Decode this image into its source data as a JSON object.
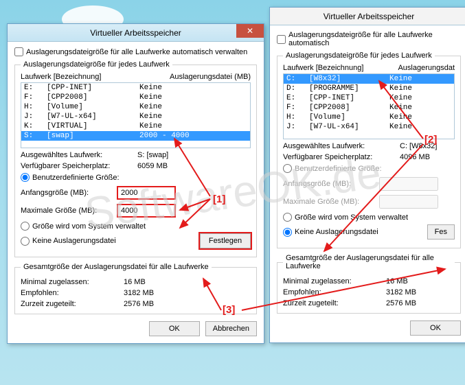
{
  "watermark": "SoftwareOK.de",
  "annotations": {
    "a1": "[1]",
    "a2": "[2]",
    "a3": "[3]"
  },
  "dialog1": {
    "title": "Virtueller Arbeitsspeicher",
    "auto_checkbox_label": "Auslagerungsdateigröße für alle Laufwerke automatisch verwalten",
    "group_label": "Auslagerungsdateigröße für jedes Laufwerk",
    "col_drive": "Laufwerk [Bezeichnung]",
    "col_page": "Auslagerungsdatei (MB)",
    "drives": [
      {
        "d": "E:",
        "n": "[CPP-INET]",
        "p": "Keine"
      },
      {
        "d": "F:",
        "n": "[CPP2008]",
        "p": "Keine"
      },
      {
        "d": "H:",
        "n": "[Volume]",
        "p": "Keine"
      },
      {
        "d": "J:",
        "n": "[W7-UL-x64]",
        "p": "Keine"
      },
      {
        "d": "K:",
        "n": "[VIRTUAL]",
        "p": "Keine"
      },
      {
        "d": "S:",
        "n": "[swap]",
        "p": "2000 - 4000",
        "selected": true
      }
    ],
    "selected_label": "Ausgewähltes Laufwerk:",
    "selected_value": "S:  [swap]",
    "free_label": "Verfügbarer Speicherplatz:",
    "free_value": "6059 MB",
    "radio_custom": "Benutzerdefinierte Größe:",
    "init_label": "Anfangsgröße (MB):",
    "init_value": "2000",
    "max_label": "Maximale Größe (MB):",
    "max_value": "4000",
    "radio_system": "Größe wird vom System verwaltet",
    "radio_none": "Keine Auslagerungsdatei",
    "set_btn": "Festlegen",
    "totals_label": "Gesamtgröße der Auslagerungsdatei für alle Laufwerke",
    "min_label": "Minimal zugelassen:",
    "min_value": "16 MB",
    "rec_label": "Empfohlen:",
    "rec_value": "3182 MB",
    "cur_label": "Zurzeit zugeteilt:",
    "cur_value": "2576 MB",
    "ok": "OK",
    "cancel": "Abbrechen"
  },
  "dialog2": {
    "title": "Virtueller Arbeitsspeicher",
    "auto_checkbox_label": "Auslagerungsdateigröße für alle Laufwerke automatisch",
    "group_label": "Auslagerungsdateigröße für jedes Laufwerk",
    "col_drive": "Laufwerk [Bezeichnung]",
    "col_page": "Auslagerungsdat",
    "drives": [
      {
        "d": "C:",
        "n": "[W8x32]",
        "p": "Keine",
        "selected": true
      },
      {
        "d": "D:",
        "n": "[PROGRAMME]",
        "p": "Keine"
      },
      {
        "d": "E:",
        "n": "[CPP-INET]",
        "p": "Keine"
      },
      {
        "d": "F:",
        "n": "[CPP2008]",
        "p": "Keine"
      },
      {
        "d": "H:",
        "n": "[Volume]",
        "p": "Keine"
      },
      {
        "d": "J:",
        "n": "[W7-UL-x64]",
        "p": "Keine"
      }
    ],
    "selected_label": "Ausgewähltes Laufwerk:",
    "selected_value": "C:  [W8x32]",
    "free_label": "Verfügbarer Speicherplatz:",
    "free_value": "4096 MB",
    "radio_custom": "Benutzerdefinierte Größe:",
    "init_label": "Anfangsgröße (MB):",
    "max_label": "Maximale Größe (MB):",
    "radio_system": "Größe wird vom System verwaltet",
    "radio_none": "Keine Auslagerungsdatei",
    "set_btn": "Fes",
    "totals_label": "Gesamtgröße der Auslagerungsdatei für alle Laufwerke",
    "min_label": "Minimal zugelassen:",
    "min_value": "16 MB",
    "rec_label": "Empfohlen:",
    "rec_value": "3182 MB",
    "cur_label": "Zurzeit zugeteilt:",
    "cur_value": "2576 MB",
    "ok": "OK"
  }
}
